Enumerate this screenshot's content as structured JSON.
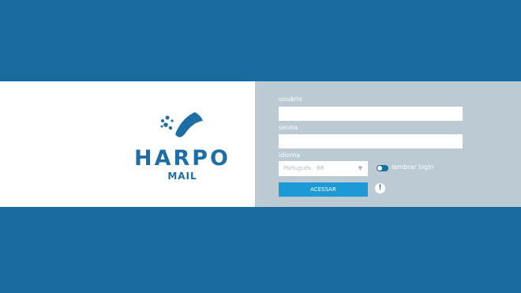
{
  "brand": {
    "name": "HARPO",
    "product": "MAIL"
  },
  "form": {
    "username_label": "usuário",
    "username_value": "",
    "password_label": "senha",
    "password_value": "",
    "language_label": "idioma",
    "language_selected": "Português - BR",
    "remember_label": "lembrar login",
    "submit_label": "ACESSAR",
    "info_glyph": "!"
  },
  "colors": {
    "background": "#186ca0",
    "panel": "#bccad4",
    "accent": "#1c9ad6",
    "brand": "#1d6ea6"
  }
}
